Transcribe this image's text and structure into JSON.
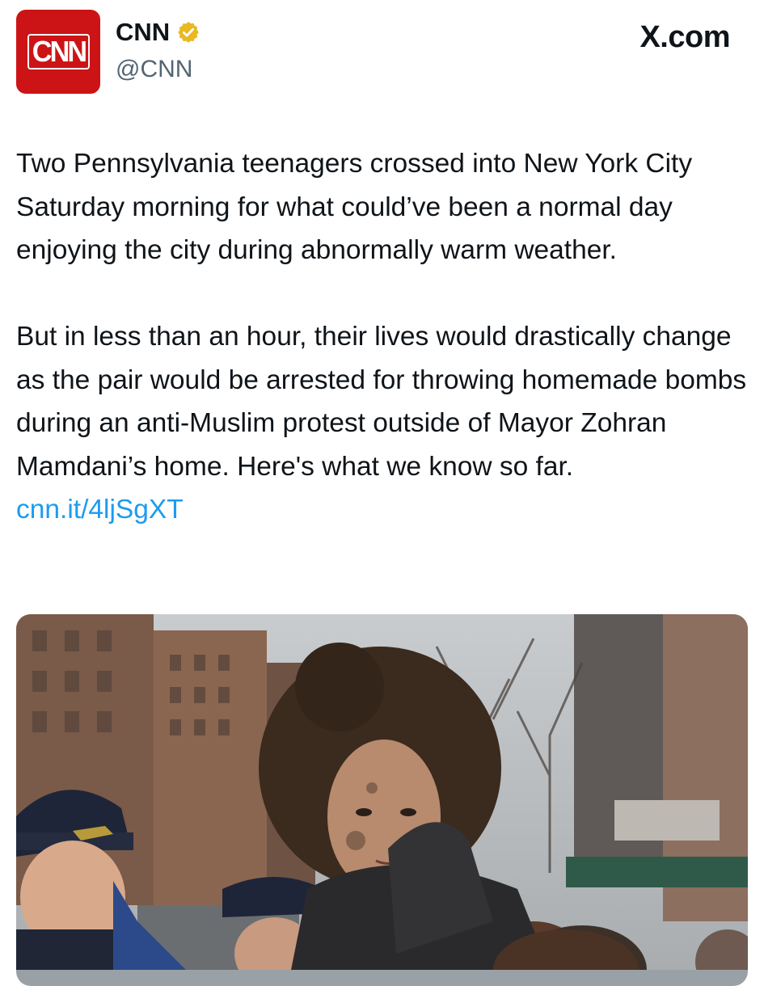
{
  "header": {
    "avatar_text": "CNN",
    "display_name": "CNN",
    "handle": "@CNN",
    "site_label": "X.com",
    "verified_color": "#e8b923"
  },
  "tweet": {
    "paragraph1": "Two Pennsylvania teenagers crossed into New York City Saturday morning for what could’ve been a normal day enjoying the city during abnormally warm weather.",
    "paragraph2_text": "But in less than an hour, their lives would drastically change as the pair would be arrested for throwing homemade bombs during an anti-Muslim protest outside of Mayor Zohran Mamdani’s home. Here's what we know so far.",
    "link": "cnn.it/4ljSgXT"
  },
  "colors": {
    "brand_red": "#cc1417",
    "link_blue": "#1d9bf0",
    "text": "#0f1419",
    "muted": "#536471"
  }
}
